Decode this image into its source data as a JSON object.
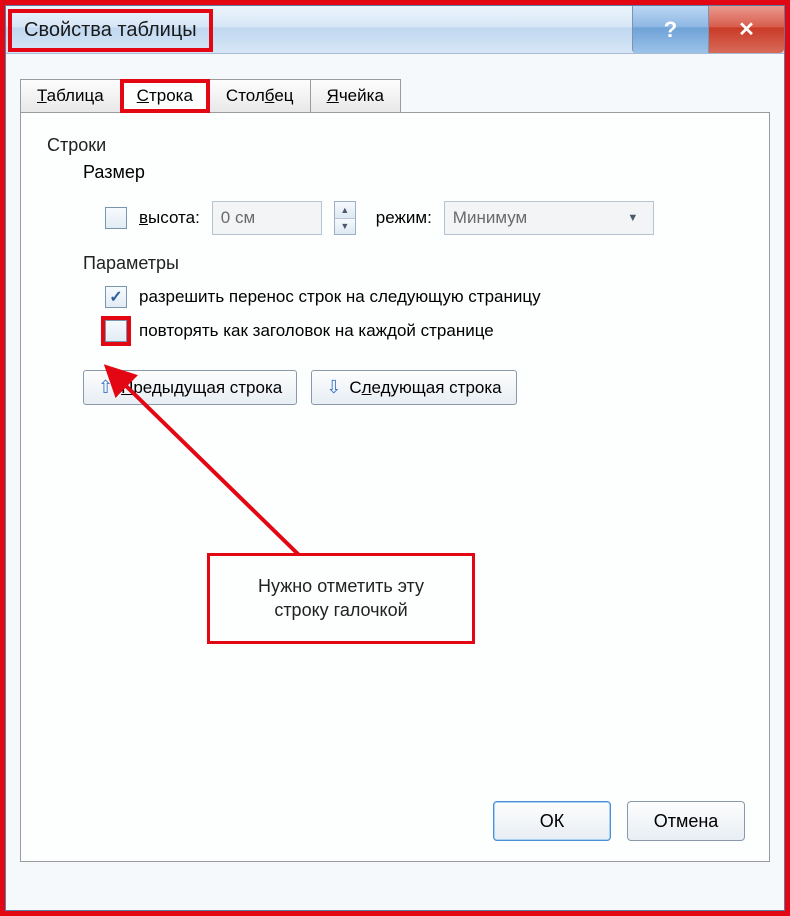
{
  "titlebar": {
    "title": "Свойства таблицы"
  },
  "tabs": {
    "table": "Таблица",
    "row": "Строка",
    "column": "Столбец",
    "cell": "Ячейка"
  },
  "panel": {
    "rows_label": "Строки",
    "size_label": "Размер",
    "height_label_pre": "в",
    "height_label_post": "ысота:",
    "height_value": "0 см",
    "mode_label": "режим:",
    "mode_value": "Минимум",
    "params_label": "Параметры",
    "allow_break": "разрешить перенос строк на следующую страницу",
    "repeat_header_pre": "повторять как ",
    "repeat_header_u": "з",
    "repeat_header_post": "аголовок на каждой странице",
    "prev_row_pre": "П",
    "prev_row_post": "редыдущая строка",
    "next_row_pre": "С",
    "next_row_u": "л",
    "next_row_post": "едующая строка"
  },
  "annotation": {
    "line1": "Нужно отметить эту",
    "line2": "строку галочкой"
  },
  "buttons": {
    "ok": "ОК",
    "cancel": "Отмена"
  }
}
